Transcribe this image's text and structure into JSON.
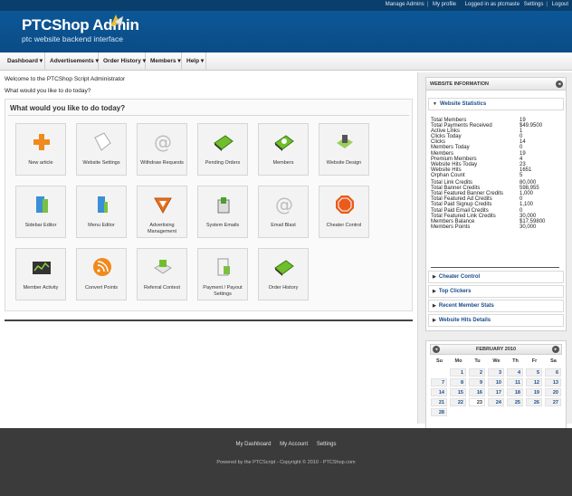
{
  "header": {
    "top_links": [
      "Manage Admins",
      "My profile",
      "Logged in as ptcmaste",
      "Settings",
      "Logout"
    ],
    "logo_title": "PTCShop Admin",
    "logo_subtitle": "ptc website backend interface"
  },
  "nav": {
    "items": [
      "Dashboard ▾",
      "Advertisements ▾",
      "Order History ▾",
      "Members ▾",
      "Help ▾"
    ]
  },
  "main": {
    "welcome": "Welcome to the PTCShop Script Administrator",
    "question": "What would you like to do today?",
    "panel_title": "What would you like to do today?",
    "tiles": [
      {
        "label": "New article",
        "icon": "plus-icon"
      },
      {
        "label": "Website Settings",
        "icon": "page-icon"
      },
      {
        "label": "Withdraw Requests",
        "icon": "at-icon"
      },
      {
        "label": "Pending Orders",
        "icon": "green-book-icon"
      },
      {
        "label": "Members",
        "icon": "members-book-icon"
      },
      {
        "label": "Website Design",
        "icon": "design-icon"
      },
      {
        "label": "Sidebar Editor",
        "icon": "sidebar-icon"
      },
      {
        "label": "Menu Editor",
        "icon": "menu-icon"
      },
      {
        "label": "Advertising Management",
        "icon": "megaphone-icon"
      },
      {
        "label": "System Emails",
        "icon": "email-box-icon"
      },
      {
        "label": "Email Blast",
        "icon": "at-icon"
      },
      {
        "label": "Cheater Control",
        "icon": "stop-icon"
      },
      {
        "label": "Member Activity",
        "icon": "chart-icon"
      },
      {
        "label": "Convert Points",
        "icon": "rss-icon"
      },
      {
        "label": "Referral Contest",
        "icon": "contest-icon"
      },
      {
        "label": "Payment / Payout Settings",
        "icon": "payment-icon"
      },
      {
        "label": "Order History",
        "icon": "green-book-icon"
      }
    ]
  },
  "sidebar": {
    "box_title": "WEBSITE INFORMATION",
    "collapse_glyph": "◂",
    "stats_title": "Website Statistics",
    "stats": [
      {
        "k": "Total Members",
        "v": "19"
      },
      {
        "k": "Total Payments Received",
        "v": "$49.9500"
      },
      {
        "k": "Active Links",
        "v": "1"
      },
      {
        "k": "Clicks Today",
        "v": "0"
      },
      {
        "k": "Clicks",
        "v": "14"
      },
      {
        "k": "Members Today",
        "v": "0"
      },
      {
        "k": "Members",
        "v": "19"
      },
      {
        "k": "Premium Members",
        "v": "4"
      },
      {
        "k": "Website Hits Today",
        "v": "23"
      },
      {
        "k": "Website Hits",
        "v": "1651"
      },
      {
        "k": "Orphan Count",
        "v": "5"
      },
      {
        "k": "Total Link Credits",
        "v": "80,000"
      },
      {
        "k": "Total Banner Credits",
        "v": "598,955"
      },
      {
        "k": "Total Featured Banner Credits",
        "v": "1,000"
      },
      {
        "k": "Total Featured Ad Credits",
        "v": "0"
      },
      {
        "k": "Total Paid Signup Credits",
        "v": "1,100"
      },
      {
        "k": "Total Paid Email Credits",
        "v": "0"
      },
      {
        "k": "Total Featured Link Credits",
        "v": "30,000"
      },
      {
        "k": "Members Balance",
        "v": "$17.59800"
      },
      {
        "k": "Members Points",
        "v": "30,000"
      }
    ],
    "sections": [
      "Cheater Control",
      "Top Clickers",
      "Recent Member Stats",
      "Website Hits Details"
    ]
  },
  "calendar": {
    "title": "FEBRUARY 2010",
    "prev_glyph": "◂",
    "next_glyph": "▸",
    "dow": [
      "Su",
      "Mo",
      "Tu",
      "We",
      "Th",
      "Fr",
      "Sa"
    ],
    "weeks": [
      [
        "",
        "1",
        "2",
        "3",
        "4",
        "5",
        "6"
      ],
      [
        "7",
        "8",
        "9",
        "10",
        "11",
        "12",
        "13"
      ],
      [
        "14",
        "15",
        "16",
        "17",
        "18",
        "19",
        "20"
      ],
      [
        "21",
        "22",
        "23",
        "24",
        "25",
        "26",
        "27"
      ],
      [
        "28",
        "",
        "",
        "",
        "",
        "",
        ""
      ]
    ],
    "today": "23"
  },
  "footer": {
    "links": [
      "My Dashboard",
      "My Account",
      "Settings"
    ],
    "copyright": "Powered by the PTCScript - Copyright © 2010 - PTCShop.com"
  }
}
